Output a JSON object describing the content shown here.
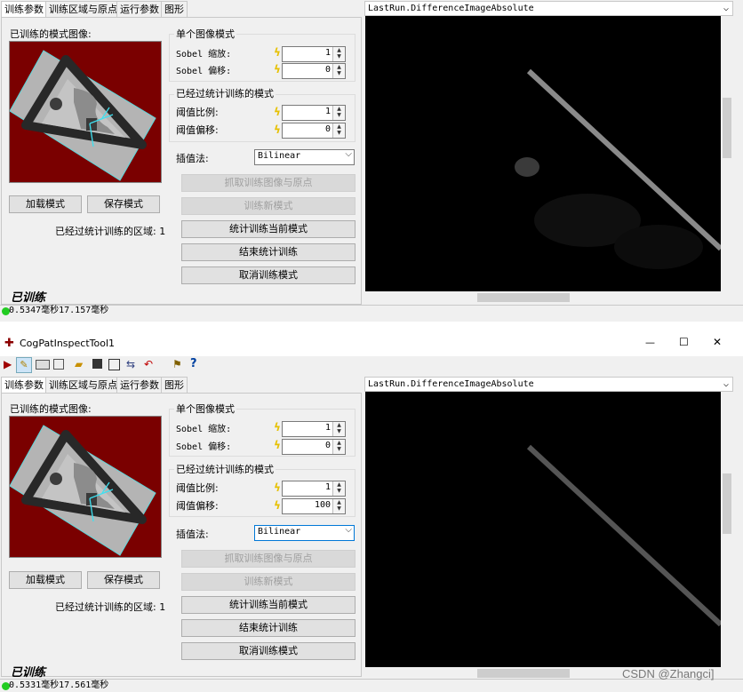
{
  "tabs": [
    "训练参数",
    "训练区域与原点",
    "运行参数",
    "图形"
  ],
  "trained_image_label": "已训练的模式图像:",
  "single_group": {
    "title": "单个图像模式",
    "sobel_scale_label": "Sobel 缩放:",
    "sobel_offset_label": "Sobel 偏移:"
  },
  "stats_group": {
    "title": "已经过统计训练的模式",
    "ratio_label": "阈值比例:",
    "offset_label": "阈值偏移:"
  },
  "interp_label": "插值法:",
  "interp_value": "Bilinear",
  "buttons": {
    "load": "加载模式",
    "save": "保存模式",
    "grab": "抓取训练图像与原点",
    "train_new": "训练新模式",
    "stat_train": "统计训练当前模式",
    "end_stat": "结束统计训练",
    "cancel": "取消训练模式"
  },
  "regions_label": "已经过统计训练的区域: 1",
  "trained_label": "已训练",
  "image_title": "LastRun.DifferenceImageAbsolute",
  "top": {
    "sobel_scale": "1",
    "sobel_offset": "0",
    "ratio": "1",
    "offset": "0",
    "status": "0.5347毫秒17.157毫秒"
  },
  "window": {
    "title": "CogPatInspectTool1",
    "min": "—",
    "max": "☐",
    "close": "✕",
    "bottom": {
      "sobel_scale": "1",
      "sobel_offset": "0",
      "ratio": "1",
      "offset": "100",
      "status": "0.5331毫秒17.561毫秒"
    }
  },
  "watermark": "CSDN @Zhangci]",
  "colors": {
    "pattern_bg": "#7a0000",
    "accent_border": "#0078d7",
    "status_green": "#22cc22"
  }
}
